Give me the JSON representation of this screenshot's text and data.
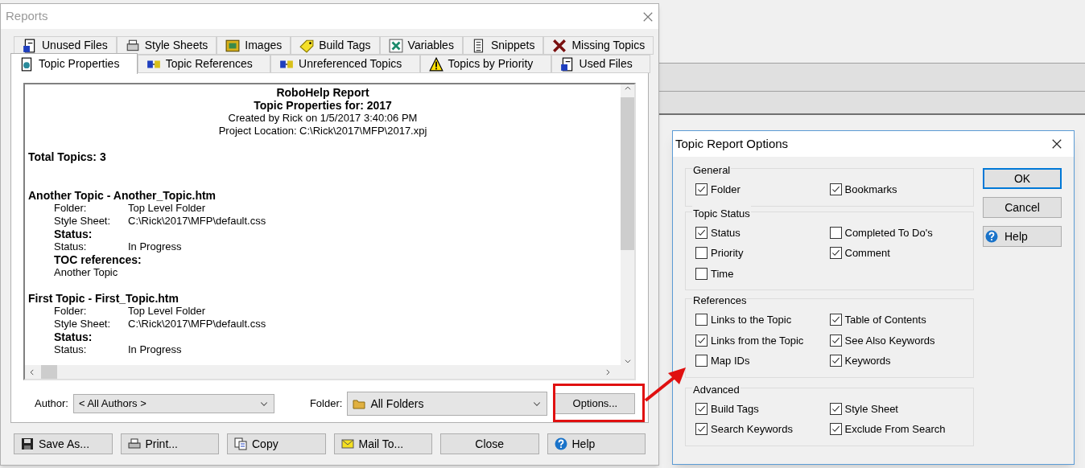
{
  "reports_window": {
    "title": "Reports",
    "tab_rows": [
      [
        {
          "label": "Unused Files",
          "selected": false
        },
        {
          "label": "Style Sheets",
          "selected": false
        },
        {
          "label": "Images",
          "selected": false
        },
        {
          "label": "Build Tags",
          "selected": false
        },
        {
          "label": "Variables",
          "selected": false
        },
        {
          "label": "Snippets",
          "selected": false
        },
        {
          "label": "Missing Topics",
          "selected": false
        }
      ],
      [
        {
          "label": "Topic Properties",
          "selected": true
        },
        {
          "label": "Topic References",
          "selected": false
        },
        {
          "label": "Unreferenced Topics",
          "selected": false
        },
        {
          "label": "Topics by Priority",
          "selected": false
        },
        {
          "label": "Used Files",
          "selected": false
        }
      ]
    ],
    "report": [
      {
        "kind": "title",
        "text": "RoboHelp Report"
      },
      {
        "kind": "title",
        "text": "Topic Properties for: 2017"
      },
      {
        "kind": "meta",
        "text": "Created by Rick on 1/5/2017 3:40:06 PM"
      },
      {
        "kind": "meta",
        "text": "Project Location: C:\\Rick\\2017\\MFP\\2017.xpj"
      },
      {
        "kind": "total",
        "text": "Total Topics: 3"
      },
      {
        "kind": "topic",
        "text": "Another Topic - Another_Topic.htm"
      },
      {
        "kind": "field",
        "label": "Folder:",
        "value": "Top Level Folder"
      },
      {
        "kind": "field",
        "label": "Style Sheet:",
        "value": "C:\\Rick\\2017\\MFP\\default.css"
      },
      {
        "kind": "heading",
        "text": "Status:"
      },
      {
        "kind": "field",
        "label": "Status:",
        "value": "In Progress"
      },
      {
        "kind": "heading",
        "text": "TOC references:"
      },
      {
        "kind": "text",
        "text": "Another Topic"
      },
      {
        "kind": "topic",
        "text": "First Topic - First_Topic.htm"
      },
      {
        "kind": "field",
        "label": "Folder:",
        "value": "Top Level Folder"
      },
      {
        "kind": "field",
        "label": "Style Sheet:",
        "value": "C:\\Rick\\2017\\MFP\\default.css"
      },
      {
        "kind": "heading",
        "text": "Status:"
      },
      {
        "kind": "field",
        "label": "Status:",
        "value": "In Progress"
      }
    ],
    "author": {
      "label": "Author:",
      "value": "< All Authors >"
    },
    "folder": {
      "label": "Folder:",
      "value": "All Folders"
    },
    "options_button": "Options...",
    "buttons": [
      {
        "label": "Save As..."
      },
      {
        "label": "Print..."
      },
      {
        "label": "Copy"
      },
      {
        "label": "Mail To..."
      },
      {
        "label": "Close"
      },
      {
        "label": "Help"
      }
    ]
  },
  "options_dialog": {
    "title": "Topic Report Options",
    "groups": [
      {
        "title": "General",
        "items": [
          {
            "label": "Folder",
            "checked": true
          },
          {
            "label": "Bookmarks",
            "checked": true
          }
        ]
      },
      {
        "title": "Topic Status",
        "items": [
          {
            "label": "Status",
            "checked": true
          },
          {
            "label": "Completed To Do's",
            "checked": false
          },
          {
            "label": "Priority",
            "checked": false
          },
          {
            "label": "Comment",
            "checked": true
          },
          {
            "label": "Time",
            "checked": false
          }
        ]
      },
      {
        "title": "References",
        "items": [
          {
            "label": "Links to the Topic",
            "checked": false
          },
          {
            "label": "Table of Contents",
            "checked": true
          },
          {
            "label": "Links from the Topic",
            "checked": true
          },
          {
            "label": "See Also Keywords",
            "checked": true
          },
          {
            "label": "Map IDs",
            "checked": false
          },
          {
            "label": "Keywords",
            "checked": true
          }
        ]
      },
      {
        "title": "Advanced",
        "items": [
          {
            "label": "Build Tags",
            "checked": true
          },
          {
            "label": "Style Sheet",
            "checked": true
          },
          {
            "label": "Search Keywords",
            "checked": true
          },
          {
            "label": "Exclude From Search",
            "checked": true
          }
        ]
      }
    ],
    "buttons": [
      {
        "label": "OK",
        "kind": "default"
      },
      {
        "label": "Cancel",
        "kind": "plain"
      },
      {
        "label": "Help",
        "kind": "help"
      }
    ]
  }
}
